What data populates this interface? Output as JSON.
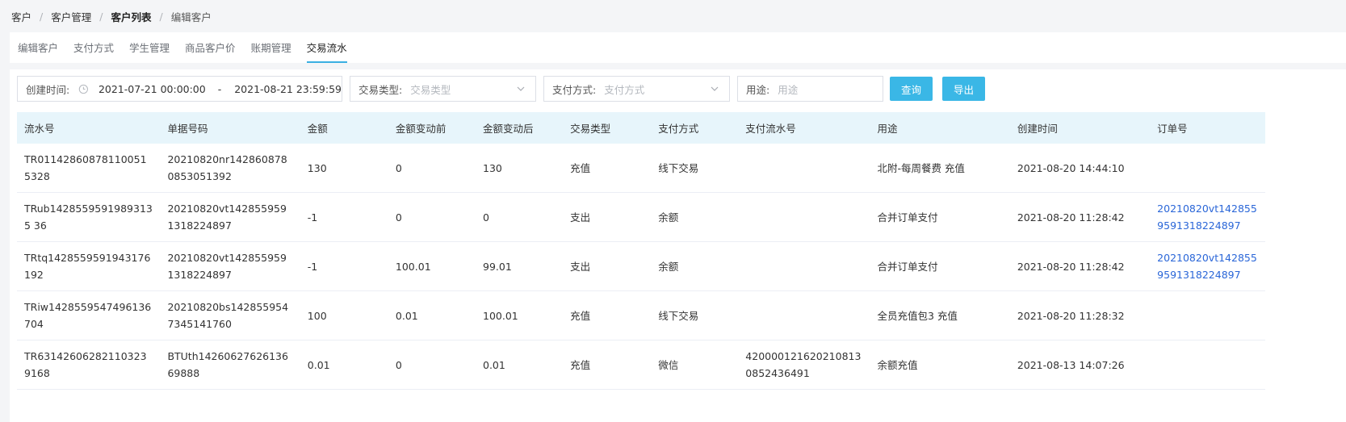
{
  "breadcrumb": {
    "items": [
      "客户",
      "客户管理",
      "客户列表",
      "编辑客户"
    ],
    "separator": "/"
  },
  "tabs": [
    {
      "label": "编辑客户",
      "active": false
    },
    {
      "label": "支付方式",
      "active": false
    },
    {
      "label": "学生管理",
      "active": false
    },
    {
      "label": "商品客户价",
      "active": false
    },
    {
      "label": "账期管理",
      "active": false
    },
    {
      "label": "交易流水",
      "active": true
    }
  ],
  "filters": {
    "created_label": "创建时间:",
    "date_start": "2021-07-21 00:00:00",
    "date_sep": "-",
    "date_end": "2021-08-21 23:59:59",
    "type_label": "交易类型:",
    "type_placeholder": "交易类型",
    "pay_label": "支付方式:",
    "pay_placeholder": "支付方式",
    "purpose_label": "用途:",
    "purpose_placeholder": "用途",
    "search_button": "查询",
    "export_button": "导出"
  },
  "table": {
    "headers": [
      "流水号",
      "单据号码",
      "金额",
      "金额变动前",
      "金额变动后",
      "交易类型",
      "支付方式",
      "支付流水号",
      "用途",
      "创建时间",
      "订单号"
    ],
    "rows": [
      [
        "TR011428608781100515328",
        "20210820nr1428608780853051392",
        "130",
        "0",
        "130",
        "充值",
        "线下交易",
        "",
        "北附-每周餐费 充值",
        "2021-08-20 14:44:10",
        ""
      ],
      [
        "TRub14285595919893135 36",
        "20210820vt1428559591318224897",
        "-1",
        "0",
        "0",
        "支出",
        "余额",
        "",
        "合并订单支付",
        "2021-08-20 11:28:42",
        "20210820vt1428559591318224897"
      ],
      [
        "TRtq1428559591943176192",
        "20210820vt1428559591318224897",
        "-1",
        "100.01",
        "99.01",
        "支出",
        "余额",
        "",
        "合并订单支付",
        "2021-08-20 11:28:42",
        "20210820vt1428559591318224897"
      ],
      [
        "TRiw1428559547496136704",
        "20210820bs1428559547345141760",
        "100",
        "0.01",
        "100.01",
        "充值",
        "线下交易",
        "",
        "全员充值包3 充值",
        "2021-08-20 11:28:32",
        ""
      ],
      [
        "TR631426062821103239168",
        "BTUth1426062762613669888",
        "0.01",
        "0",
        "0.01",
        "充值",
        "微信",
        "4200001216202108130852436491",
        "余额充值",
        "2021-08-13 14:07:26",
        ""
      ]
    ]
  },
  "colors": {
    "accent": "#3ab7e6",
    "header_bg": "#e7f5fb",
    "link": "#2a66d8"
  },
  "icons": {
    "clock": "clock-icon",
    "chevron": "chevron-down-icon"
  }
}
